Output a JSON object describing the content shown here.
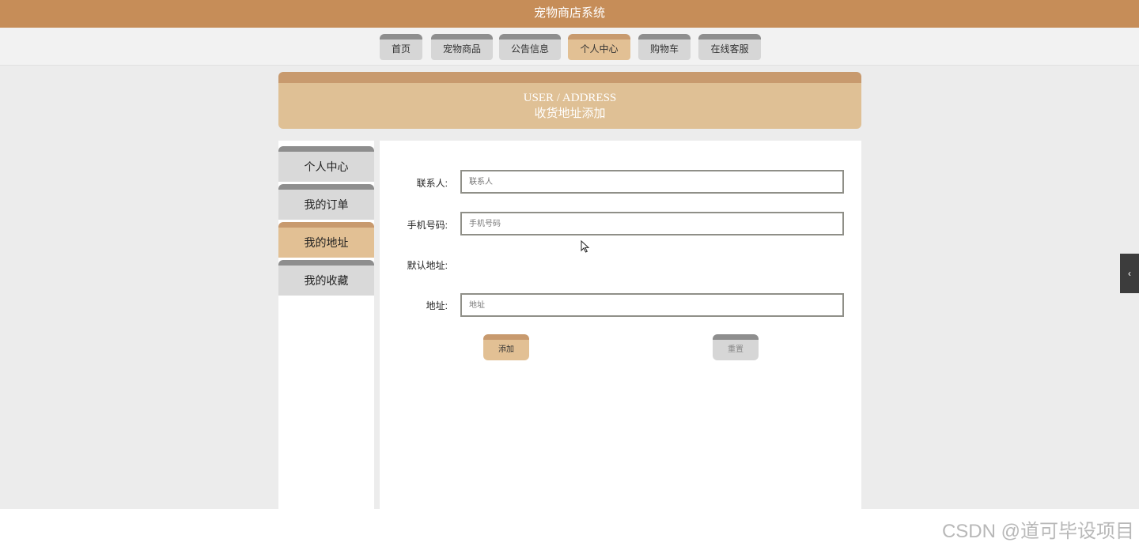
{
  "app": {
    "title": "宠物商店系统"
  },
  "nav": [
    {
      "label": "首页",
      "active": false
    },
    {
      "label": "宠物商品",
      "active": false
    },
    {
      "label": "公告信息",
      "active": false
    },
    {
      "label": "个人中心",
      "active": true
    },
    {
      "label": "购物车",
      "active": false
    },
    {
      "label": "在线客服",
      "active": false
    }
  ],
  "header": {
    "title_en": "USER / ADDRESS",
    "title_cn": "收货地址添加"
  },
  "sidebar": {
    "items": [
      {
        "label": "个人中心",
        "active": false
      },
      {
        "label": "我的订单",
        "active": false
      },
      {
        "label": "我的地址",
        "active": true
      },
      {
        "label": "我的收藏",
        "active": false
      }
    ]
  },
  "form": {
    "contact": {
      "label": "联系人:",
      "value": "",
      "placeholder": "联系人"
    },
    "phone": {
      "label": "手机号码:",
      "value": "",
      "placeholder": "手机号码"
    },
    "default": {
      "label": "默认地址:"
    },
    "address": {
      "label": "地址:",
      "value": "",
      "placeholder": "地址"
    },
    "add_label": "添加",
    "reset_label": "重置"
  },
  "side_tab": {
    "icon": "chevron-left-icon",
    "glyph": "‹"
  },
  "watermark": "CSDN @道可毕设项目",
  "colors": {
    "brand": "#c68d58",
    "accent_light": "#e2c094",
    "tab_top_inactive": "#8e8e8e"
  }
}
